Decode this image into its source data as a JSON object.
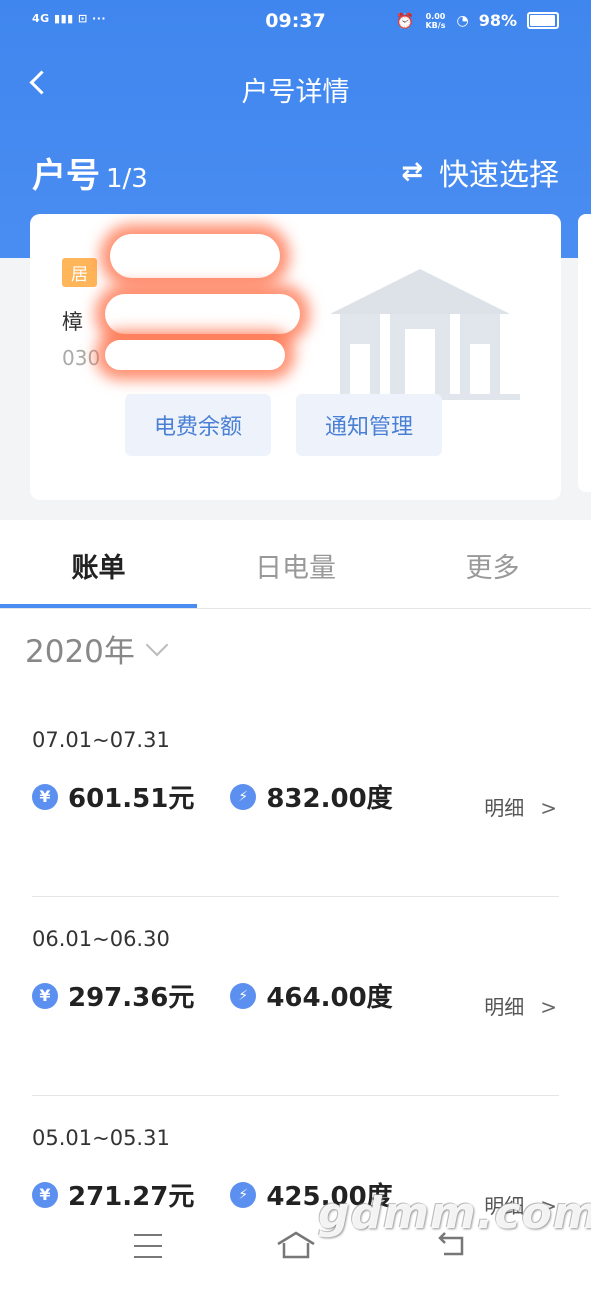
{
  "status_bar": {
    "network": "4G ▮▮▮ ⊡ ···",
    "time": "09:37",
    "speed": "0.00 KB/s",
    "battery": "98%"
  },
  "header": {
    "title": "户号详情",
    "account_label": "户号",
    "account_count": "1/3",
    "quick_select": "快速选择"
  },
  "card": {
    "tag": "居",
    "address": "樟",
    "account_number": "030",
    "buttons": [
      "电费余额",
      "通知管理"
    ]
  },
  "tabs": [
    "账单",
    "日电量",
    "更多"
  ],
  "year": "2020年",
  "bills": [
    {
      "period": "07.01~07.31",
      "amount": "601.51元",
      "usage": "832.00度",
      "detail": "明细",
      "arrow": ">"
    },
    {
      "period": "06.01~06.30",
      "amount": "297.36元",
      "usage": "464.00度",
      "detail": "明细",
      "arrow": ">"
    },
    {
      "period": "05.01~05.31",
      "amount": "271.27元",
      "usage": "425.00度",
      "detail": "明细",
      "arrow": ">"
    }
  ],
  "icons": {
    "currency": "¥",
    "energy": "⚡"
  },
  "watermark": "gdmm.com",
  "colors": {
    "primary": "#4a8df2",
    "tag": "#ffb65a",
    "button_text": "#4a7fd6"
  }
}
